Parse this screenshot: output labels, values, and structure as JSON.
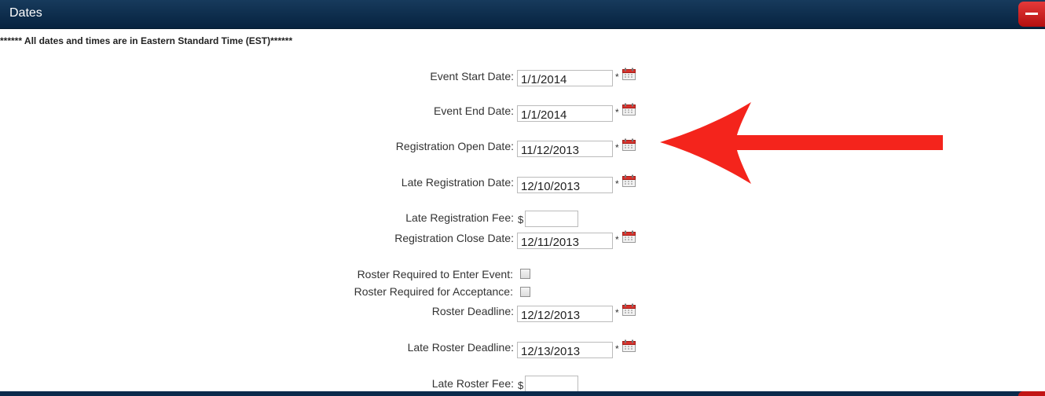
{
  "header": {
    "title": "Dates"
  },
  "notice": "****** All dates and times are in Eastern Standard Time (EST)******",
  "required_mark": "*",
  "currency_symbol": "$",
  "fields": {
    "event_start_date": {
      "label": "Event Start Date:",
      "value": "1/1/2014"
    },
    "event_end_date": {
      "label": "Event End Date:",
      "value": "1/1/2014"
    },
    "registration_open_date": {
      "label": "Registration Open Date:",
      "value": "11/12/2013"
    },
    "late_registration_date": {
      "label": "Late Registration Date:",
      "value": "12/10/2013"
    },
    "late_registration_fee": {
      "label": "Late Registration Fee:",
      "value": ""
    },
    "registration_close_date": {
      "label": "Registration Close Date:",
      "value": "12/11/2013"
    },
    "roster_required_enter": {
      "label": "Roster Required to Enter Event:",
      "checked": false
    },
    "roster_required_accept": {
      "label": "Roster Required for Acceptance:",
      "checked": false
    },
    "roster_deadline": {
      "label": "Roster Deadline:",
      "value": "12/12/2013"
    },
    "late_roster_deadline": {
      "label": "Late Roster Deadline:",
      "value": "12/13/2013"
    },
    "late_roster_fee": {
      "label": "Late Roster Fee:",
      "value": ""
    }
  },
  "colors": {
    "header_bg": "#06223f",
    "collapse_button": "#c21515",
    "annotation_arrow": "#f4241c"
  },
  "icons": {
    "calendar": "calendar-icon",
    "collapse": "minus-icon",
    "annotation": "arrow-icon"
  }
}
